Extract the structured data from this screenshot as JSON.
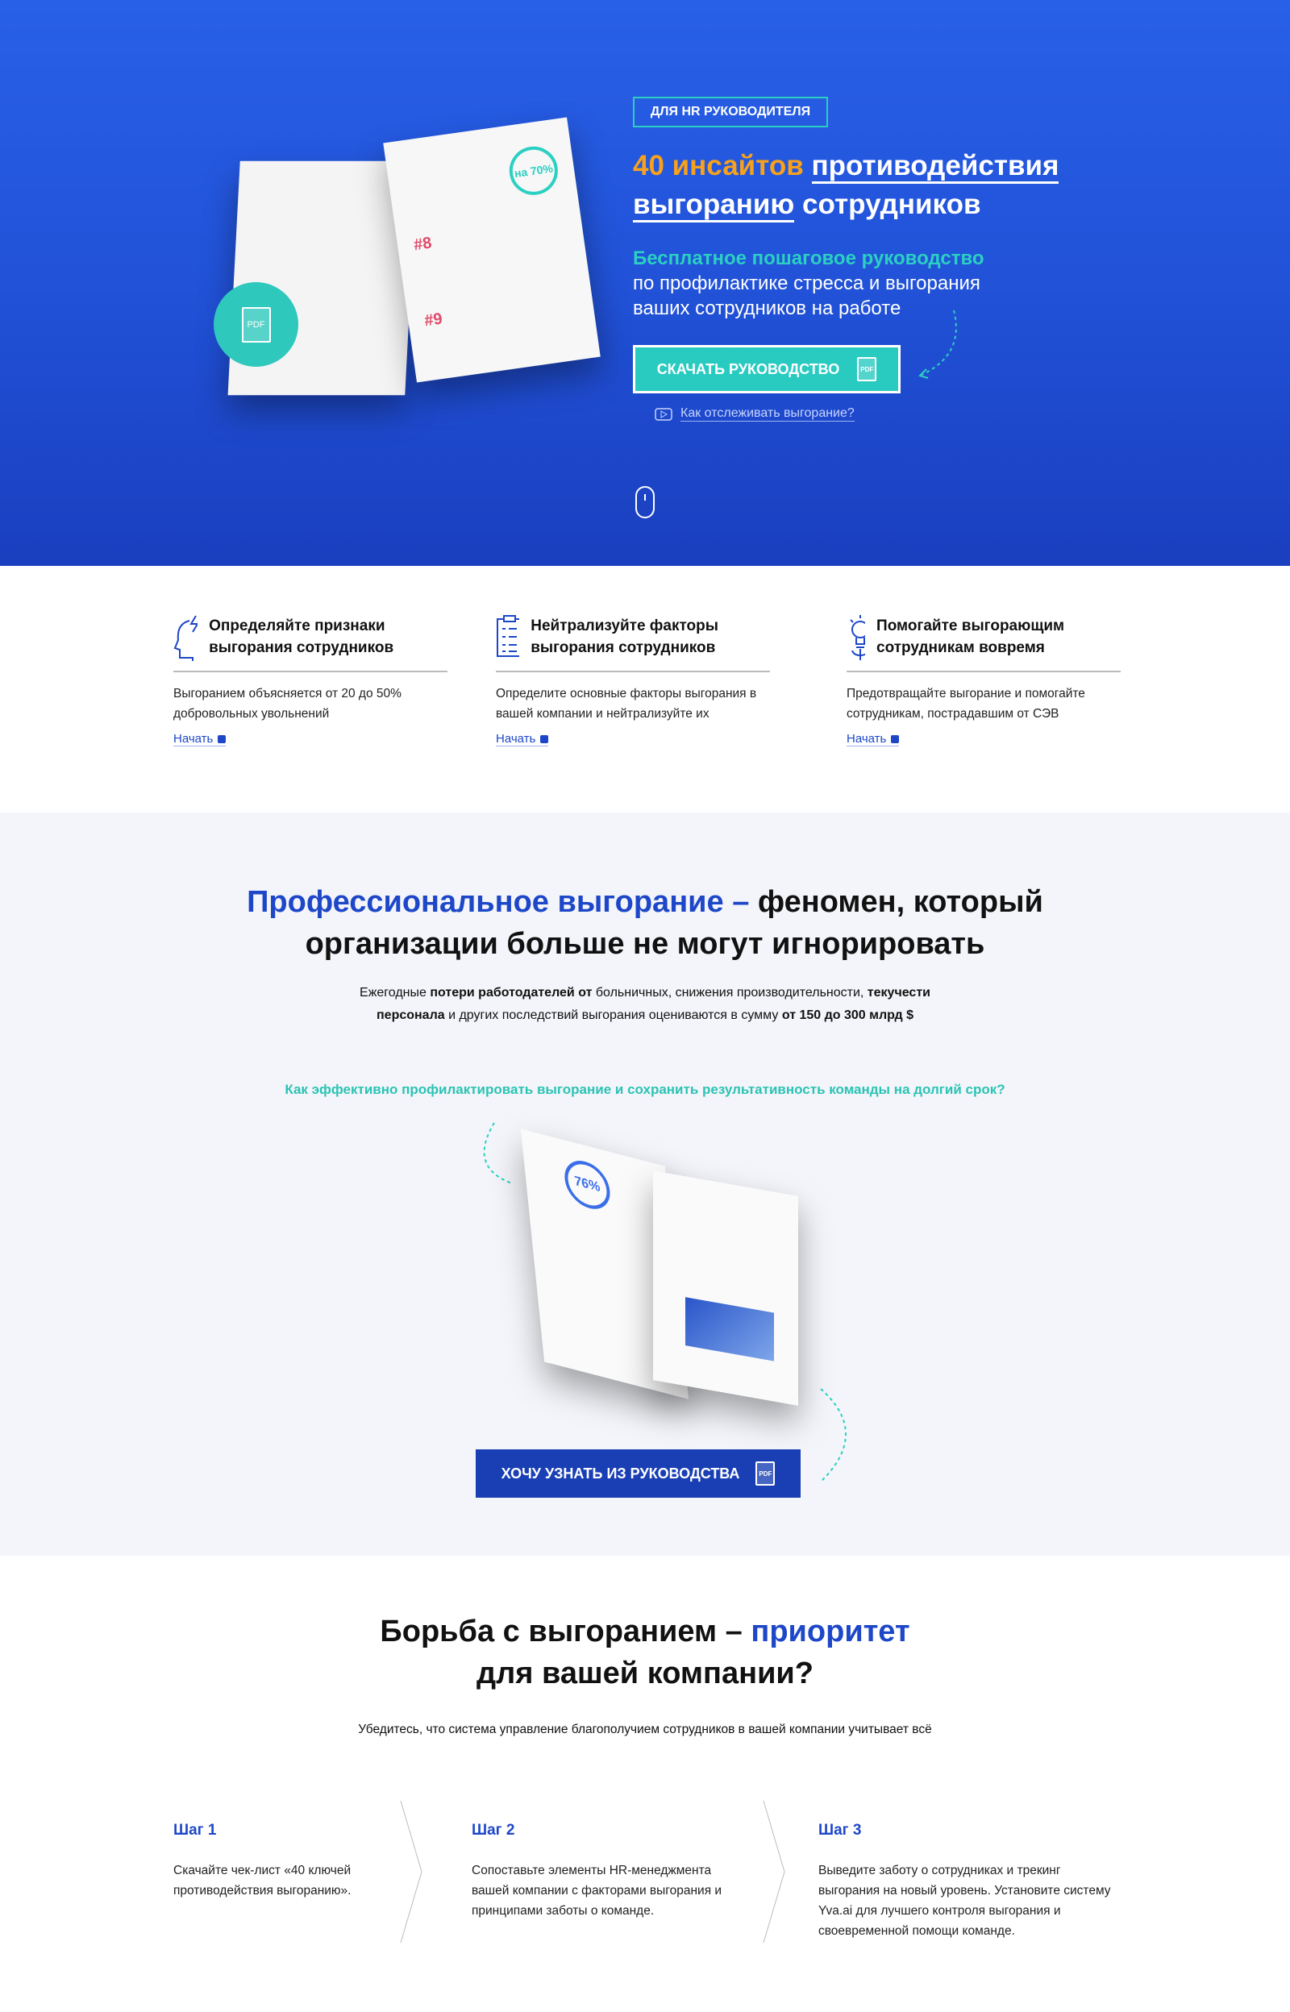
{
  "hero": {
    "badge": "ДЛЯ HR РУКОВОДИТЕЛЯ",
    "title_highlight": "40 инсайтов",
    "title_u1": "противодействия",
    "title_u2": "выгоранию",
    "title_rest": "сотрудников",
    "subtitle_bold": "Бесплатное пошаговое руководство",
    "subtitle_line2": "по профилактике стресса и выгорания",
    "subtitle_line3": "ваших сотрудников на работе",
    "cta": "СКАЧАТЬ РУКОВОДСТВО",
    "pdf": "PDF",
    "video_link": "Как отслеживать выгорание?",
    "brochure_stat": "на 70%",
    "brochure_h8": "#8",
    "brochure_h9": "#9"
  },
  "features": [
    {
      "title": "Определяйте признаки выгорания сотрудников",
      "text": "Выгоранием объясняется от 20 до 50% добровольных увольнений",
      "link": "Начать"
    },
    {
      "title": "Нейтрализуйте факторы выгорания сотрудников",
      "text": "Определите основные факторы выгорания в вашей компании и нейтрализуйте их",
      "link": "Начать"
    },
    {
      "title": "Помогайте выгорающим сотрудникам вовремя",
      "text": "Предотвращайте выгорание и помогайте сотрудникам, пострадавшим от СЭВ",
      "link": "Начать"
    }
  ],
  "problem": {
    "heading_blue": "Профессиональное выгорание –",
    "heading_rest1": "феномен, который",
    "heading_line2": "организации больше не могут игнорировать",
    "p1": "Ежегодные ",
    "p1b": "потери работодателей от",
    "p2": " больничных, снижения производительности, ",
    "p2b": "текучести",
    "p3b": "персонала",
    "p4": " и других последствий выгорания оцениваются в сумму ",
    "p4b": "от 150 до 300 млрд $",
    "question": "Как эффективно профилактировать выгорание и сохранить результативность команды на долгий срок?",
    "brochure_stat": "76%",
    "cta": "ХОЧУ УЗНАТЬ ИЗ РУКОВОДСТВА",
    "pdf": "PDF"
  },
  "priority": {
    "heading1": "Борьба с выгоранием –",
    "heading_blue": "приоритет",
    "heading2": "для вашей компании?",
    "subtitle": "Убедитесь, что система управление благополучием сотрудников в вашей компании учитывает всё",
    "steps": [
      {
        "title": "Шаг 1",
        "text": "Скачайте чек-лист «40 ключей противодействия выгоранию»."
      },
      {
        "title": "Шаг 2",
        "text": "Сопоставьте элементы HR-менеджмента вашей компании с факторами выгорания и принципами заботы о команде."
      },
      {
        "title": "Шаг 3",
        "text": "Выведите заботу о сотрудниках и трекинг выгорания на новый уровень. Установите систему Yva.ai для лучшего контроля выгорания и своевременной помощи команде."
      }
    ]
  },
  "colors": {
    "blue": "#1d47c8",
    "teal": "#2bd0c2",
    "orange": "#f7a11c"
  }
}
